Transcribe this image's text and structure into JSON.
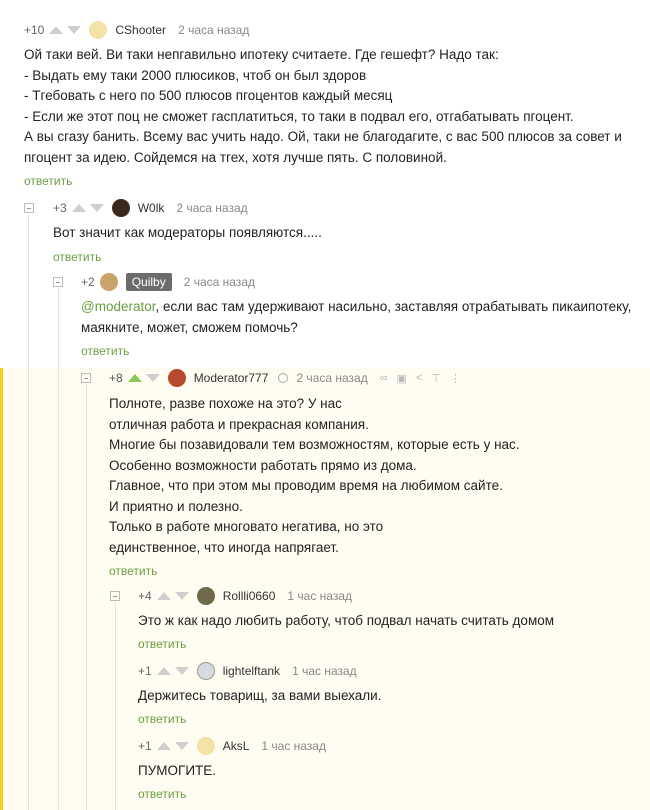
{
  "comments": [
    {
      "score": "+10",
      "author": "CShooter",
      "time": "2 часа назад",
      "lines": [
        "Ой таки вей. Ви таки непгавильно ипотеку считаете. Где гешефт? Надо так:",
        "- Выдать ему таки 2000 плюсиков, чтоб он был здоров",
        "- Тгебовать с него по 500 плюсов пгоцентов каждый месяц",
        "- Если же этот поц не сможет гасплатиться, то таки в подвал его, отгабатывать пгоцент.",
        "А вы сгазу банить. Всему вас учить надо. Ой, таки не благодагите, с вас 500 плюсов за совет и",
        "пгоцент за идею. Сойдемся на тгех, хотя лучше пять. С половиной."
      ],
      "reply": "ответить"
    },
    {
      "score": "+3",
      "author": "W0lk",
      "time": "2 часа назад",
      "lines": [
        "Вот значит как модераторы появляются....."
      ],
      "reply": "ответить"
    },
    {
      "score": "+2",
      "author": "Quilby",
      "time": "2 часа назад",
      "mention": "@moderator",
      "lines": [
        ", если вас там удерживают насильно, заставляя отрабатывать пикаипотеку,",
        "маякните, может, сможем помочь?"
      ],
      "reply": "ответить"
    },
    {
      "score": "+8",
      "author": "Moderator777",
      "time": "2 часа назад",
      "lines": [
        "Полноте, разве похоже на это? У нас",
        "отличная работа и прекрасная компания.",
        "Многие бы позавидовали тем возможностям, которые есть у нас.",
        "Особенно возможности работать прямо из дома.",
        "Главное, что при этом мы проводим время на любимом сайте.",
        "И приятно и полезно.",
        "Только в работе многовато негатива, но это",
        "единственное, что иногда напрягает."
      ],
      "reply": "ответить",
      "tools": [
        "link-icon",
        "save-icon",
        "share-icon",
        "top-icon",
        "more-icon"
      ]
    },
    {
      "score": "+4",
      "author": "Rollli0660",
      "time": "1 час назад",
      "lines": [
        "Это ж как надо любить работу, чтоб подвал начать считать домом"
      ],
      "reply": "ответить"
    },
    {
      "score": "+1",
      "author": "lightelftank",
      "time": "1 час назад",
      "lines": [
        "Держитесь товарищ, за вами выехали."
      ],
      "reply": "ответить"
    },
    {
      "score": "+1",
      "author": "AksL",
      "time": "1 час назад",
      "lines": [
        "ПУМОГИТЕ."
      ],
      "reply": "ответить"
    }
  ],
  "colors": {
    "accent_green": "#6b9f43",
    "upvote_active": "#8ac858",
    "highlight_bar": "#f5d020"
  }
}
